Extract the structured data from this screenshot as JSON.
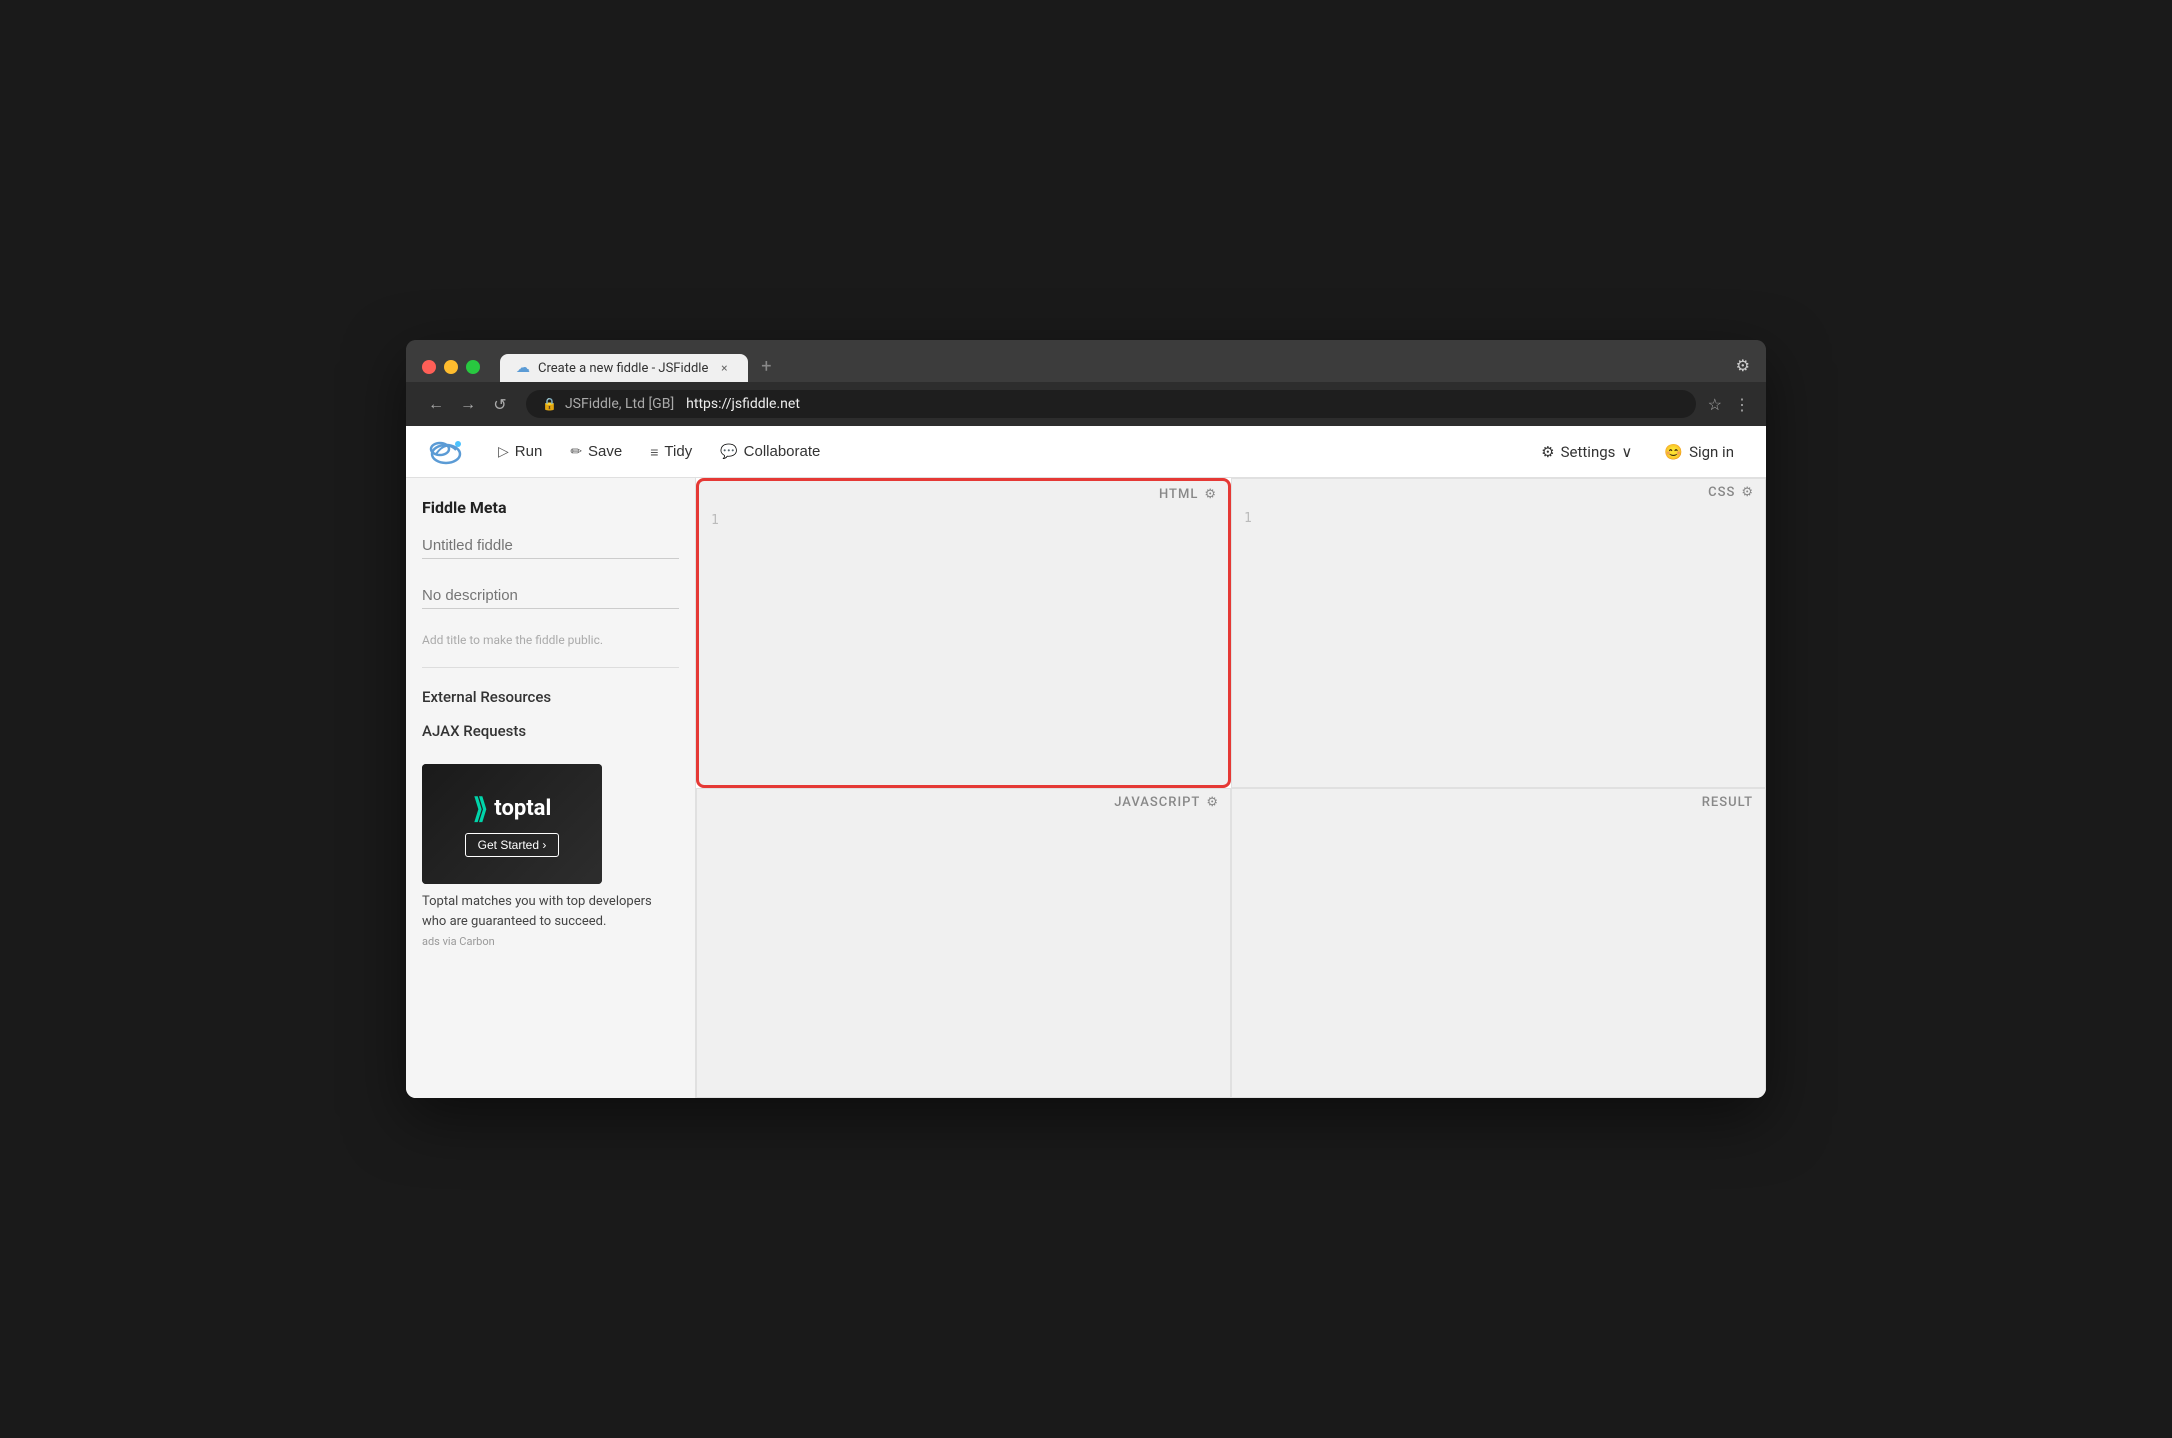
{
  "browser": {
    "tab_title": "Create a new fiddle - JSFiddle",
    "tab_close": "×",
    "new_tab": "+",
    "address": "https://jsfiddle.net",
    "site_name": "JSFiddle, Ltd [GB]",
    "nav_back": "←",
    "nav_forward": "→",
    "nav_refresh": "↺"
  },
  "toolbar": {
    "run_label": "Run",
    "save_label": "Save",
    "tidy_label": "Tidy",
    "collaborate_label": "Collaborate",
    "settings_label": "Settings",
    "sign_in_label": "Sign in"
  },
  "sidebar": {
    "meta_title": "Fiddle Meta",
    "fiddle_name": "Untitled fiddle",
    "fiddle_name_placeholder": "Untitled fiddle",
    "description_placeholder": "No description",
    "public_notice": "Add title to make the fiddle public.",
    "external_resources": "External Resources",
    "ajax_requests": "AJAX Requests"
  },
  "ad": {
    "brand": "toptal",
    "cta": "Get Started ›",
    "description": "Toptal matches you with top developers who are guaranteed to succeed.",
    "via": "ads via Carbon"
  },
  "editors": {
    "html_label": "HTML",
    "css_label": "CSS",
    "js_label": "JAVASCRIPT",
    "result_label": "RESULT",
    "line_number_html": "1",
    "line_number_css": "1"
  }
}
